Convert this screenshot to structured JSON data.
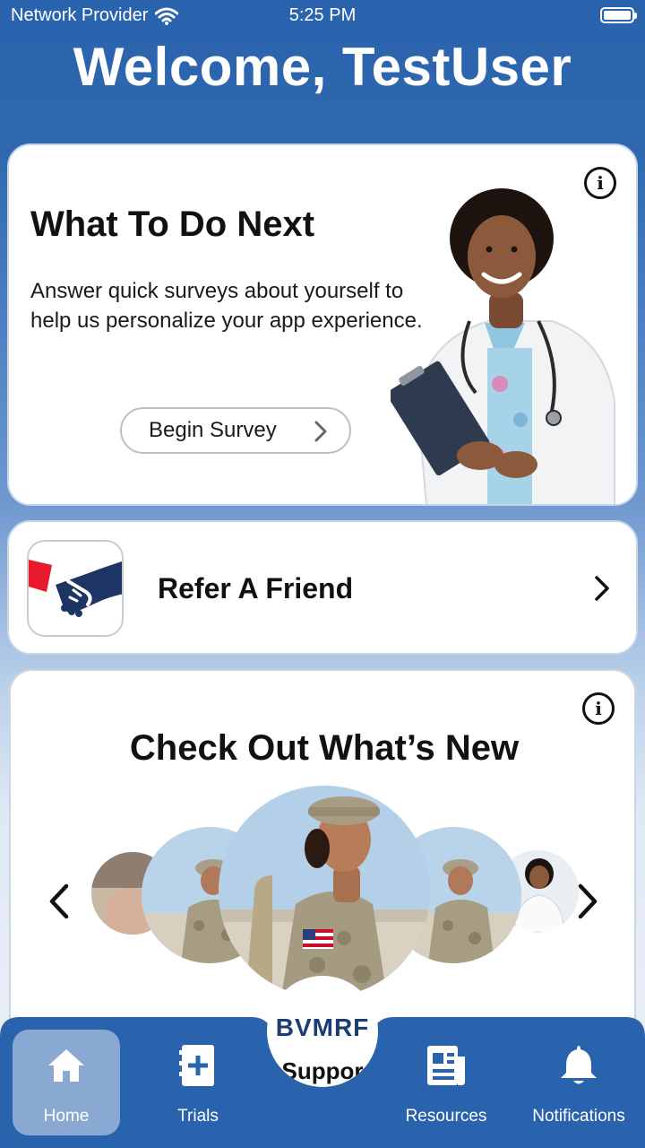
{
  "status": {
    "carrier": "Network Provider",
    "time": "5:25 PM"
  },
  "header": {
    "welcome": "Welcome, TestUser"
  },
  "next_card": {
    "title": "What To Do Next",
    "description": "Answer quick surveys about yourself to help us personalize your app experience.",
    "button_label": "Begin Survey",
    "info_icon": "info-icon"
  },
  "refer_card": {
    "label": "Refer A Friend"
  },
  "news_card": {
    "title": "Check Out What’s New",
    "info_icon": "info-icon"
  },
  "tabbar": {
    "tabs": [
      {
        "label": "Home",
        "icon": "home-icon"
      },
      {
        "label": "Trials",
        "icon": "add-document-icon"
      },
      {
        "label": "Resources",
        "icon": "newspaper-icon"
      },
      {
        "label": "Notifications",
        "icon": "bell-icon"
      }
    ],
    "center_logo": "BVMRF",
    "center_peek": "Suppor"
  },
  "colors": {
    "primary": "#2a63ad",
    "active_tab": "#8fb0d8",
    "brand_red": "#e8192c"
  }
}
